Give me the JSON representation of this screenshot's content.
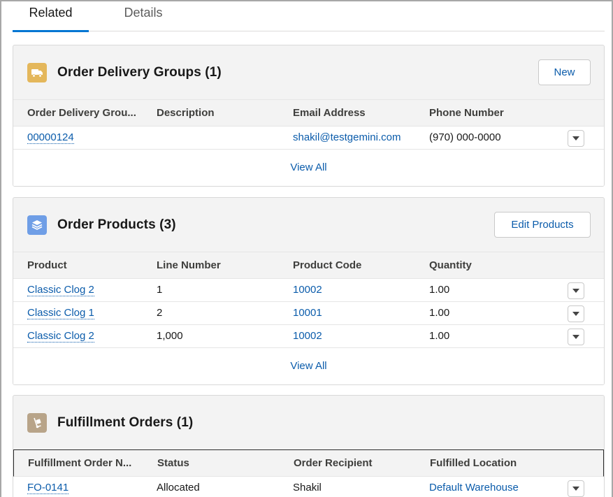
{
  "tabs": [
    {
      "label": "Related"
    },
    {
      "label": "Details"
    }
  ],
  "order_delivery_groups": {
    "title": "Order Delivery Groups (1)",
    "icon": "truck-icon",
    "icon_color": "#e4b75b",
    "button_label": "New",
    "columns": [
      "Order Delivery Grou...",
      "Description",
      "Email Address",
      "Phone Number"
    ],
    "rows": [
      {
        "number": "00000124",
        "description": "",
        "email": "shakil@testgemini.com",
        "phone": "(970) 000-0000"
      }
    ],
    "view_all": "View All"
  },
  "order_products": {
    "title": "Order Products (3)",
    "icon": "layers-icon",
    "icon_color": "#6f9ee6",
    "button_label": "Edit Products",
    "columns": [
      "Product",
      "Line Number",
      "Product Code",
      "Quantity"
    ],
    "rows": [
      {
        "product": "Classic Clog 2",
        "line_number": "1",
        "product_code": "10002",
        "quantity": "1.00"
      },
      {
        "product": "Classic Clog 1",
        "line_number": "2",
        "product_code": "10001",
        "quantity": "1.00"
      },
      {
        "product": "Classic Clog 2",
        "line_number": "1,000",
        "product_code": "10002",
        "quantity": "1.00"
      }
    ],
    "view_all": "View All"
  },
  "fulfillment_orders": {
    "title": "Fulfillment Orders (1)",
    "icon": "hand-truck-icon",
    "icon_color": "#b8a489",
    "columns": [
      "Fulfillment Order N...",
      "Status",
      "Order Recipient",
      "Fulfilled Location"
    ],
    "rows": [
      {
        "number": "FO-0141",
        "status": "Allocated",
        "recipient": "Shakil",
        "location": "Default Warehouse"
      }
    ]
  }
}
